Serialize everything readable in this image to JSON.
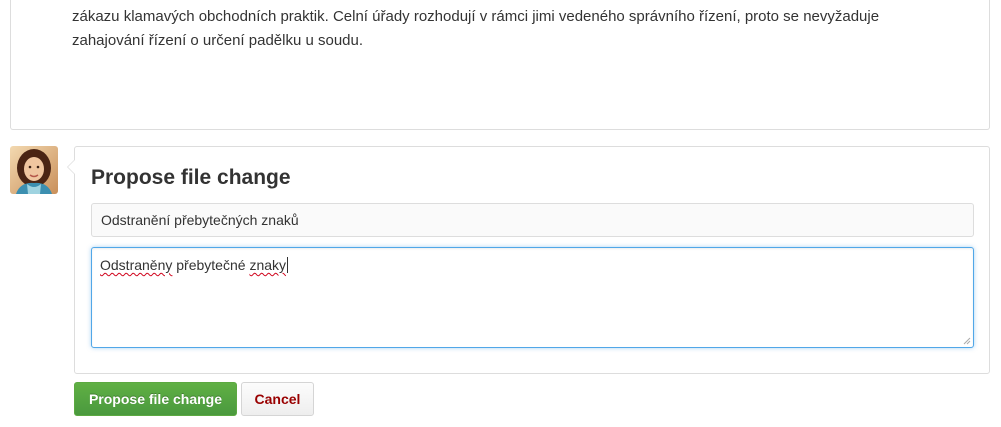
{
  "preview": {
    "lines": [
      "zákazu klamavých obchodních praktik. Celní úřady rozhodují v rámci jimi vedeného správního řízení, proto se nevyžaduje",
      "zahajování řízení o určení padělku u soudu."
    ]
  },
  "form": {
    "title": "Propose file change",
    "summary_value": "Odstranění přebytečných znaků",
    "description_words": [
      "Odstraněny",
      " přebytečné ",
      "znaky"
    ]
  },
  "buttons": {
    "submit_label": "Propose file change",
    "cancel_label": "Cancel"
  },
  "colors": {
    "primary": "#60b044",
    "cancel_text": "#990000",
    "focus_border": "#51a7e8"
  }
}
